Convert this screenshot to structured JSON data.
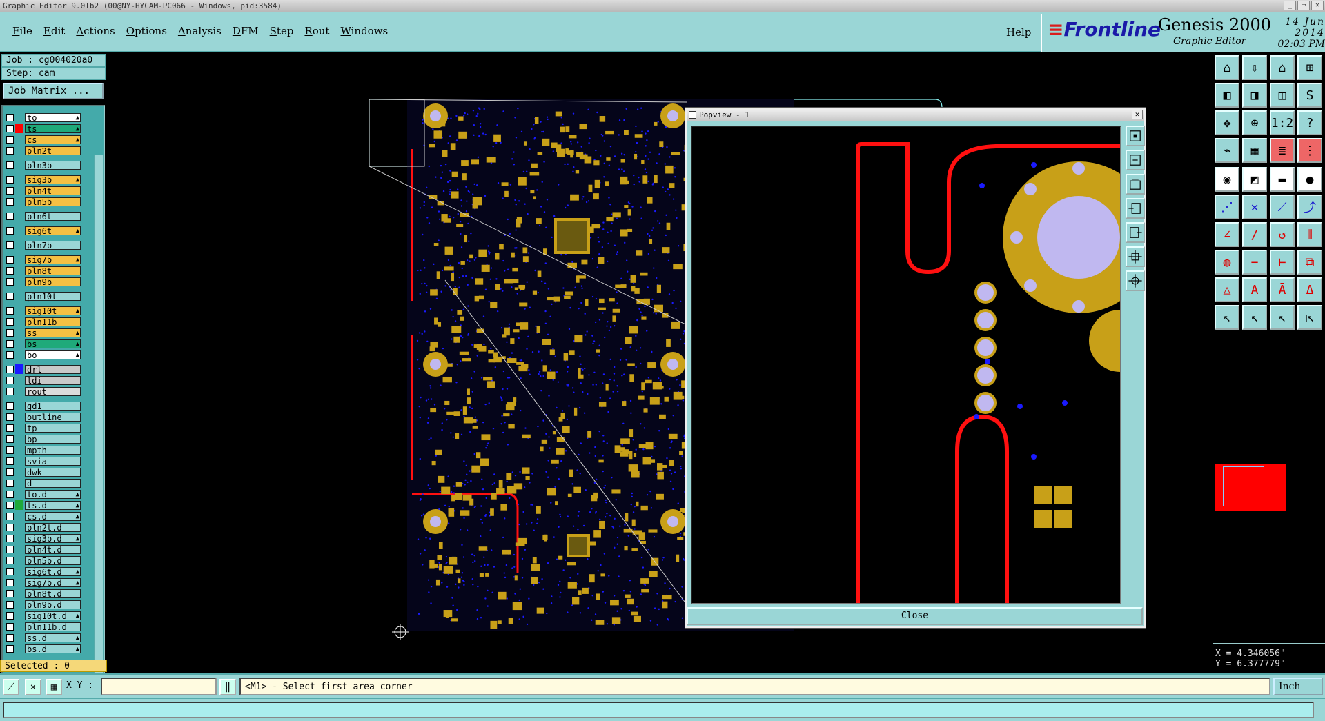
{
  "window": {
    "title": "Graphic Editor 9.0Tb2 (00@NY-HYCAM-PC066 - Windows, pid:3584)"
  },
  "menu": {
    "items": [
      "File",
      "Edit",
      "Actions",
      "Options",
      "Analysis",
      "DFM",
      "Step",
      "Rout",
      "Windows"
    ],
    "help": "Help"
  },
  "brand": {
    "logo": "Frontline",
    "product": "Genesis 2000",
    "subtitle": "Graphic Editor",
    "date": "14 Jun 2014",
    "time": "02:03 PM"
  },
  "job": {
    "job_label": "Job : cg004020a0",
    "step_label": "Step: cam",
    "matrix_button": "Job Matrix ..."
  },
  "layers": [
    {
      "name": "to",
      "color": "#ffffff",
      "swatch": "",
      "mark": "▲",
      "group": 0
    },
    {
      "name": "ts",
      "color": "#1faa7a",
      "swatch": "#ff0000",
      "mark": "▲",
      "group": 0
    },
    {
      "name": "cs",
      "color": "#f5c043",
      "swatch": "",
      "mark": "▲",
      "group": 0
    },
    {
      "name": "pln2t",
      "color": "#f5c043",
      "swatch": "",
      "mark": "",
      "group": 0
    },
    {
      "name": "pln3b",
      "color": "#9ad6d6",
      "swatch": "",
      "mark": "",
      "group": 1
    },
    {
      "name": "sig3b",
      "color": "#f5c043",
      "swatch": "",
      "mark": "▲",
      "group": 1
    },
    {
      "name": "pln4t",
      "color": "#f5c043",
      "swatch": "",
      "mark": "",
      "group": 0
    },
    {
      "name": "pln5b",
      "color": "#f5c043",
      "swatch": "",
      "mark": "",
      "group": 0
    },
    {
      "name": "pln6t",
      "color": "#9ad6d6",
      "swatch": "",
      "mark": "",
      "group": 1
    },
    {
      "name": "sig6t",
      "color": "#f5c043",
      "swatch": "",
      "mark": "▲",
      "group": 1
    },
    {
      "name": "pln7b",
      "color": "#9ad6d6",
      "swatch": "",
      "mark": "",
      "group": 1
    },
    {
      "name": "sig7b",
      "color": "#f5c043",
      "swatch": "",
      "mark": "▲",
      "group": 1
    },
    {
      "name": "pln8t",
      "color": "#f5c043",
      "swatch": "",
      "mark": "",
      "group": 0
    },
    {
      "name": "pln9b",
      "color": "#f5c043",
      "swatch": "",
      "mark": "",
      "group": 0
    },
    {
      "name": "pln10t",
      "color": "#9ad6d6",
      "swatch": "",
      "mark": "",
      "group": 1
    },
    {
      "name": "sig10t",
      "color": "#f5c043",
      "swatch": "",
      "mark": "▲",
      "group": 1
    },
    {
      "name": "pln11b",
      "color": "#f5c043",
      "swatch": "",
      "mark": "",
      "group": 0
    },
    {
      "name": "ss",
      "color": "#f5c043",
      "swatch": "",
      "mark": "▲",
      "group": 0
    },
    {
      "name": "bs",
      "color": "#1faa7a",
      "swatch": "",
      "mark": "▲",
      "group": 0
    },
    {
      "name": "bo",
      "color": "#ffffff",
      "swatch": "",
      "mark": "▲",
      "group": 0
    },
    {
      "name": "drl",
      "color": "#c9c9c9",
      "swatch": "#1a1aff",
      "mark": "",
      "group": 1
    },
    {
      "name": "ldi",
      "color": "#c9c9c9",
      "swatch": "",
      "mark": "",
      "group": 0
    },
    {
      "name": "rout",
      "color": "#dcdcdc",
      "swatch": "",
      "mark": "",
      "group": 0
    },
    {
      "name": "gd1",
      "color": "#9ad6d6",
      "swatch": "",
      "mark": "",
      "group": 1
    },
    {
      "name": "outline",
      "color": "#9ad6d6",
      "swatch": "",
      "mark": "",
      "group": 0
    },
    {
      "name": "tp",
      "color": "#9ad6d6",
      "swatch": "",
      "mark": "",
      "group": 0
    },
    {
      "name": "bp",
      "color": "#9ad6d6",
      "swatch": "",
      "mark": "",
      "group": 0
    },
    {
      "name": "mpth",
      "color": "#9ad6d6",
      "swatch": "",
      "mark": "",
      "group": 0
    },
    {
      "name": "svia",
      "color": "#9ad6d6",
      "swatch": "",
      "mark": "",
      "group": 0
    },
    {
      "name": "dwk",
      "color": "#9ad6d6",
      "swatch": "",
      "mark": "",
      "group": 0
    },
    {
      "name": "d",
      "color": "#9ad6d6",
      "swatch": "",
      "mark": "",
      "group": 0
    },
    {
      "name": "to.d",
      "color": "#9ad6d6",
      "swatch": "",
      "mark": "▲",
      "group": 0
    },
    {
      "name": "ts.d",
      "color": "#9ad6d6",
      "swatch": "#1faa3a",
      "mark": "▲",
      "group": 0
    },
    {
      "name": "cs.d",
      "color": "#9ad6d6",
      "swatch": "",
      "mark": "▲",
      "group": 0
    },
    {
      "name": "pln2t.d",
      "color": "#9ad6d6",
      "swatch": "",
      "mark": "",
      "group": 0
    },
    {
      "name": "sig3b.d",
      "color": "#9ad6d6",
      "swatch": "",
      "mark": "▲",
      "group": 0
    },
    {
      "name": "pln4t.d",
      "color": "#9ad6d6",
      "swatch": "",
      "mark": "",
      "group": 0
    },
    {
      "name": "pln5b.d",
      "color": "#9ad6d6",
      "swatch": "",
      "mark": "",
      "group": 0
    },
    {
      "name": "sig6t.d",
      "color": "#9ad6d6",
      "swatch": "",
      "mark": "▲",
      "group": 0
    },
    {
      "name": "sig7b.d",
      "color": "#9ad6d6",
      "swatch": "",
      "mark": "▲",
      "group": 0
    },
    {
      "name": "pln8t.d",
      "color": "#9ad6d6",
      "swatch": "",
      "mark": "",
      "group": 0
    },
    {
      "name": "pln9b.d",
      "color": "#9ad6d6",
      "swatch": "",
      "mark": "",
      "group": 0
    },
    {
      "name": "sig10t.d",
      "color": "#9ad6d6",
      "swatch": "",
      "mark": "▲",
      "group": 0
    },
    {
      "name": "pln11b.d",
      "color": "#9ad6d6",
      "swatch": "",
      "mark": "",
      "group": 0
    },
    {
      "name": "ss.d",
      "color": "#9ad6d6",
      "swatch": "",
      "mark": "▲",
      "group": 0
    },
    {
      "name": "bs.d",
      "color": "#9ad6d6",
      "swatch": "",
      "mark": "▲",
      "group": 0
    }
  ],
  "selection": {
    "label": "Selected : 0"
  },
  "status": {
    "xy_label": "X Y :",
    "xy_value": "",
    "prompt": "<M1> - Select first area corner",
    "unit": "Inch"
  },
  "coords": {
    "x": "X = 4.346056\"",
    "y": "Y = 6.377779\""
  },
  "popview": {
    "title": "Popview - 1",
    "close_label": "Close"
  },
  "colors": {
    "panel": "#9ad6d6",
    "copper": "#c8a018",
    "trace": "#ff1010",
    "pad_hole": "#c0b8f0",
    "via": "#1a1aff"
  },
  "toolbar": {
    "icons": [
      "zoom-home-icon",
      "zoom-back-icon",
      "zoom-house-icon",
      "split-view-icon",
      "pan-left-icon",
      "pan-right-icon",
      "fit-icon",
      "s-shape-icon",
      "zoom-fit-icon",
      "center-icon",
      "scale-1-2-icon",
      "help-icon",
      "snap-icon",
      "grid-icon",
      "layer-stack-icon",
      "layer-mask-icon",
      "snap-point-icon",
      "rect-select-icon",
      "measure-bar-icon",
      "circle-select-icon",
      "connect-icon",
      "cross-icon",
      "line-point-icon",
      "arc-point-icon",
      "angle-line-icon",
      "slash-line-icon",
      "undo-arc-icon",
      "parallel-icon",
      "point-move-icon",
      "minus-line-icon",
      "bracket-icon",
      "copy-shape-icon",
      "triangle-a-icon",
      "triangle-b-icon",
      "triangle-c-icon",
      "triangle-d-icon",
      "pointer-icon",
      "pointer-select-icon",
      "pointer-move-icon",
      "pointer-route-icon"
    ]
  }
}
